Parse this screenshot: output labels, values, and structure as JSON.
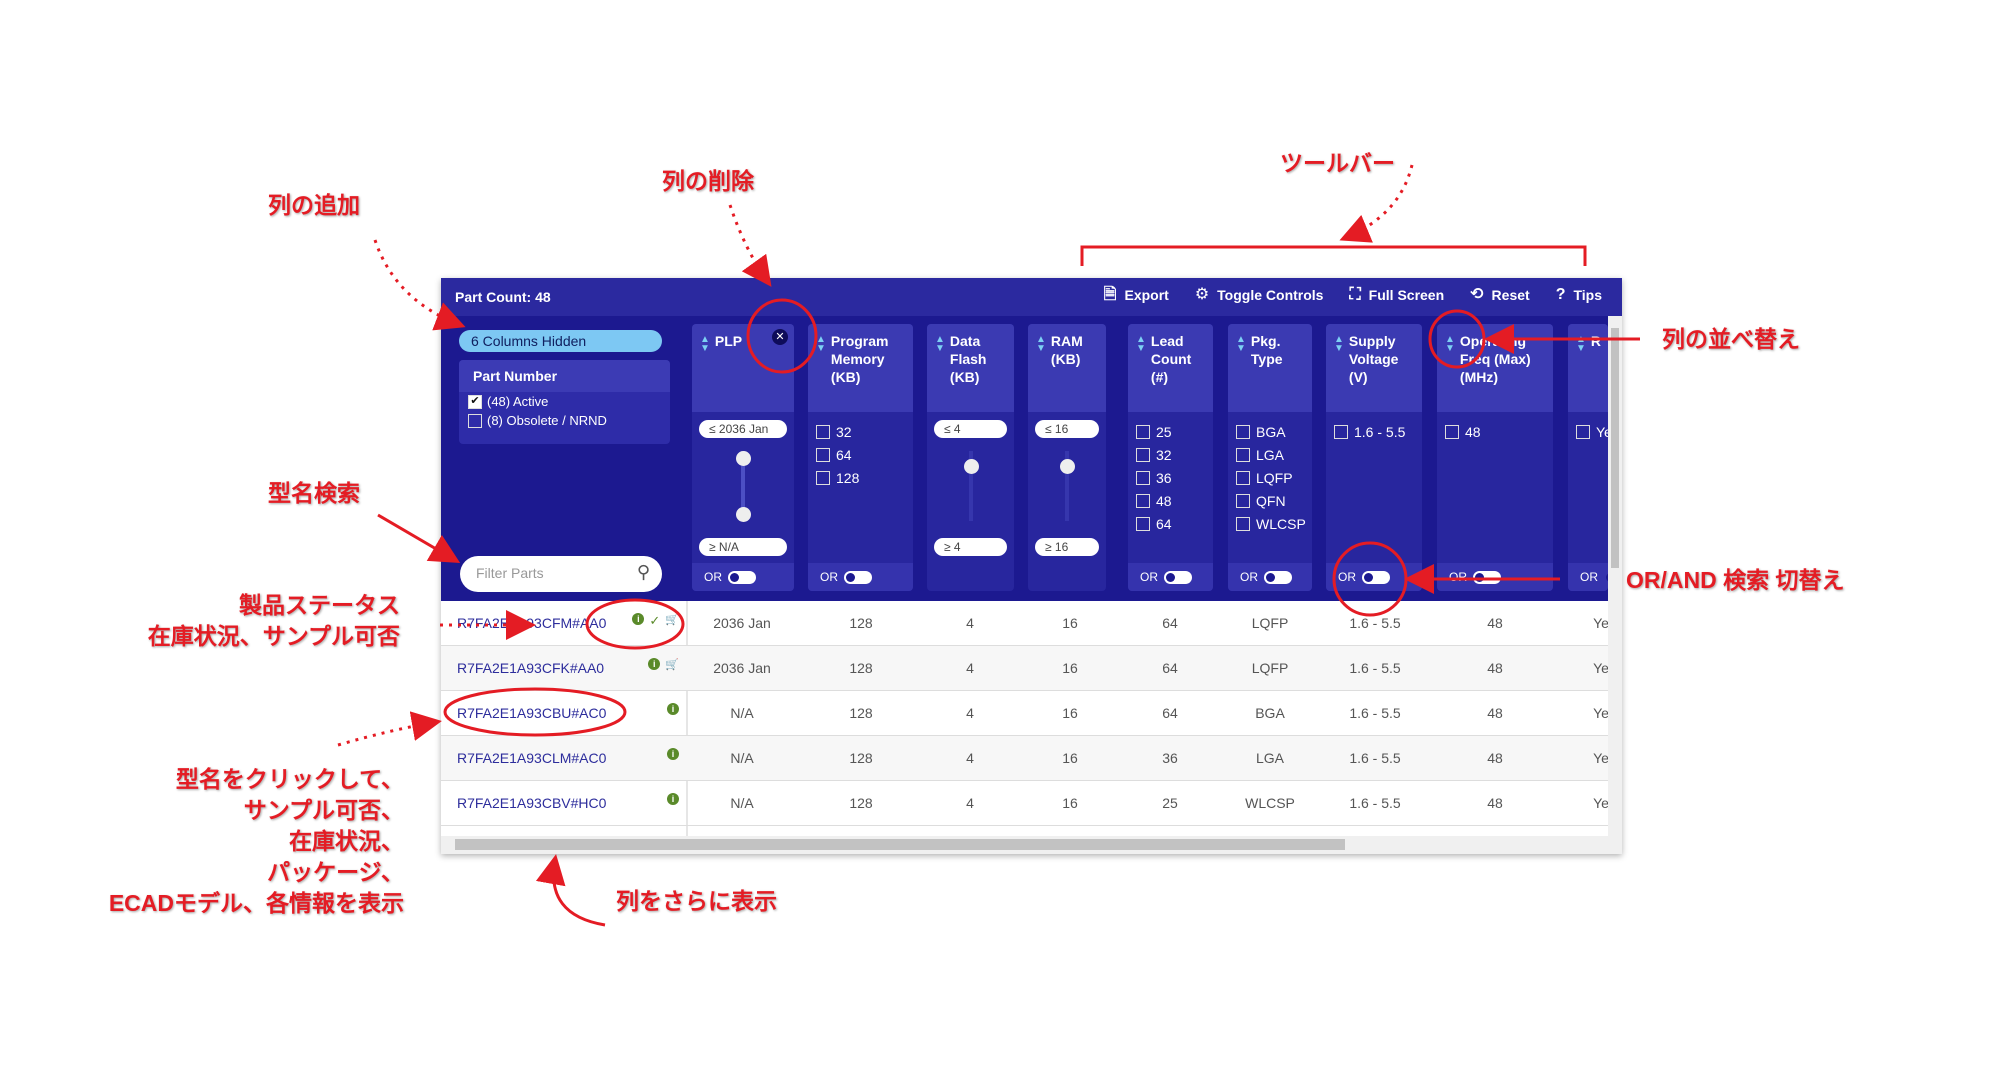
{
  "toolbar": {
    "part_count": "Part Count: 48",
    "items": [
      {
        "label": "Export",
        "icon": "export-file-icon",
        "glyph": "🗎"
      },
      {
        "label": "Toggle Controls",
        "icon": "gear-icon",
        "glyph": "⚙"
      },
      {
        "label": "Full Screen",
        "icon": "fullscreen-icon",
        "glyph": "⛶"
      },
      {
        "label": "Reset",
        "icon": "reset-icon",
        "glyph": "⟲"
      },
      {
        "label": "Tips",
        "icon": "help-icon",
        "glyph": "?"
      }
    ]
  },
  "left_filter": {
    "hidden_columns": "6 Columns Hidden",
    "part_number_header": "Part Number",
    "status_options": [
      {
        "label": "(48) Active",
        "checked": true
      },
      {
        "label": "(8) Obsolete / NRND",
        "checked": false
      }
    ],
    "search_placeholder": "Filter Parts"
  },
  "filters": [
    {
      "title": "PLP",
      "type": "range",
      "max": "2036 Jan",
      "min": "N/A",
      "removable": true
    },
    {
      "title": "Program Memory (KB)",
      "type": "checkbox",
      "options": [
        "32",
        "64",
        "128"
      ]
    },
    {
      "title": "Data Flash (KB)",
      "type": "range",
      "max": "4",
      "min": "4"
    },
    {
      "title": "RAM (KB)",
      "type": "range",
      "max": "16",
      "min": "16"
    },
    {
      "title": "Lead Count (#)",
      "type": "checkbox",
      "options": [
        "25",
        "32",
        "36",
        "48",
        "64"
      ]
    },
    {
      "title": "Pkg. Type",
      "type": "checkbox",
      "options": [
        "BGA",
        "LGA",
        "LQFP",
        "QFN",
        "WLCSP"
      ]
    },
    {
      "title": "Supply Voltage (V)",
      "type": "checkbox",
      "options": [
        "1.6 - 5.5"
      ]
    },
    {
      "title": "Operating Freq (Max) (MHz)",
      "type": "checkbox",
      "options": [
        "48"
      ]
    },
    {
      "title": "R",
      "type": "checkbox",
      "options": [
        "Ye"
      ]
    }
  ],
  "toggle_label": "OR",
  "rows": [
    {
      "part": "R7FA2E1A93CFM#AA0",
      "icons": [
        "info",
        "check",
        "cart"
      ],
      "cells": [
        "2036 Jan",
        "128",
        "4",
        "16",
        "64",
        "LQFP",
        "1.6 - 5.5",
        "48",
        "Ye"
      ]
    },
    {
      "part": "R7FA2E1A93CFK#AA0",
      "icons": [
        "info",
        "cart"
      ],
      "cells": [
        "2036 Jan",
        "128",
        "4",
        "16",
        "64",
        "LQFP",
        "1.6 - 5.5",
        "48",
        "Ye"
      ]
    },
    {
      "part": "R7FA2E1A93CBU#AC0",
      "icons": [
        "info"
      ],
      "cells": [
        "N/A",
        "128",
        "4",
        "16",
        "64",
        "BGA",
        "1.6 - 5.5",
        "48",
        "Ye"
      ]
    },
    {
      "part": "R7FA2E1A93CLM#AC0",
      "icons": [
        "info"
      ],
      "cells": [
        "N/A",
        "128",
        "4",
        "16",
        "36",
        "LGA",
        "1.6 - 5.5",
        "48",
        "Ye"
      ]
    },
    {
      "part": "R7FA2E1A93CBV#HC0",
      "icons": [
        "info"
      ],
      "cells": [
        "N/A",
        "128",
        "4",
        "16",
        "25",
        "WLCSP",
        "1.6 - 5.5",
        "48",
        "Ye"
      ]
    }
  ],
  "annotations": {
    "add_column": "列の追加",
    "remove_column": "列の削除",
    "toolbar": "ツールバー",
    "part_search": "型名検索",
    "status": [
      "製品ステータス",
      "在庫状況、サンプル可否"
    ],
    "click_part": [
      "型名をクリックして、",
      "サンプル可否、",
      "在庫状況、",
      "パッケージ、",
      "ECADモデル、各情報を表示"
    ],
    "more_columns": "列をさらに表示",
    "sort_columns": "列の並べ替え",
    "or_and": "OR/AND 検索 切替え"
  },
  "colors": {
    "panel": "#1c1990",
    "header": "#2b299f",
    "pill": "#7dc8f3",
    "link": "#2d2d9c",
    "annotation": "#e41c24",
    "info": "#5a8a2a"
  }
}
